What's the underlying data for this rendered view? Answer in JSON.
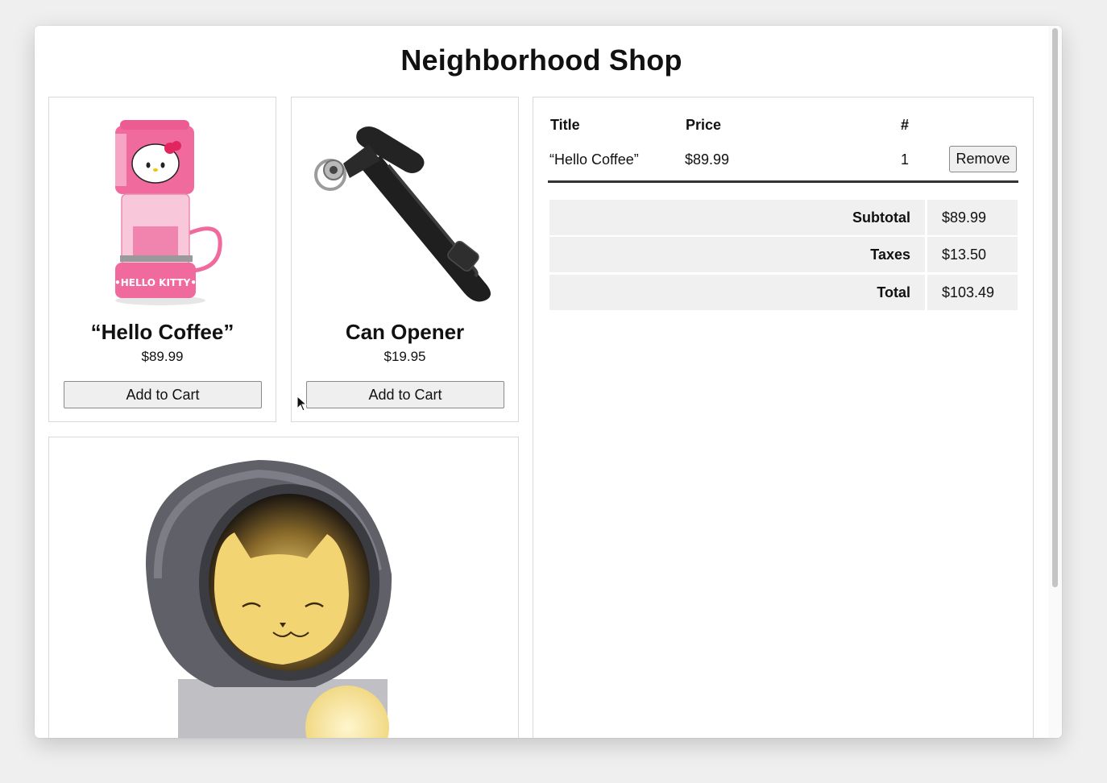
{
  "page": {
    "title": "Neighborhood Shop"
  },
  "products": [
    {
      "name": "“Hello Coffee”",
      "price": "$89.99",
      "button_label": "Add to Cart"
    },
    {
      "name": "Can Opener",
      "price": "$19.95",
      "button_label": "Add to Cart"
    }
  ],
  "cart": {
    "headers": {
      "title": "Title",
      "price": "Price",
      "qty": "#"
    },
    "items": [
      {
        "title": "“Hello Coffee”",
        "price": "$89.99",
        "qty": "1",
        "remove_label": "Remove"
      }
    ],
    "summary": {
      "subtotal_label": "Subtotal",
      "subtotal_value": "$89.99",
      "taxes_label": "Taxes",
      "taxes_value": "$13.50",
      "total_label": "Total",
      "total_value": "$103.49"
    }
  },
  "colors": {
    "card_border": "#d9d9d9",
    "summary_bg": "#f0f0f0",
    "coffee_pink": "#f06a9e"
  }
}
